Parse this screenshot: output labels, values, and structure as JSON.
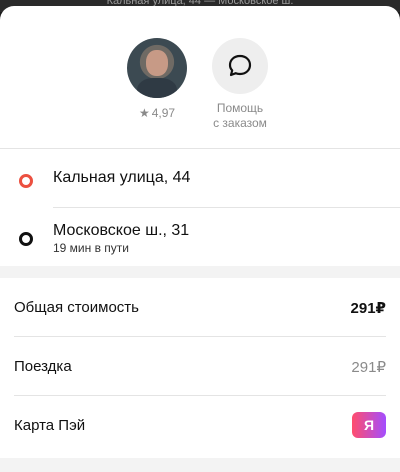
{
  "header_peek": "Кальная улица, 44 — Московское ш.",
  "driver": {
    "avatar_icon": "driver-photo",
    "rating": "4,97",
    "star_icon": "star-icon"
  },
  "support": {
    "icon": "chat-bubble-icon",
    "label_line1": "Помощь",
    "label_line2": "с заказом"
  },
  "route": {
    "from": {
      "title": "Кальная улица, 44",
      "marker_color": "#ec5040"
    },
    "to": {
      "title": "Московское ш., 31",
      "subtitle": "19 мин в пути",
      "marker_color": "#111111"
    }
  },
  "cost": {
    "total_label": "Общая стоимость",
    "total_value": "291₽",
    "trip_label": "Поездка",
    "trip_value": "291₽",
    "payment_label": "Карта Пэй",
    "payment_badge": "Я",
    "payment_badge_colors": [
      "#ff4d6d",
      "#a34dff"
    ]
  }
}
